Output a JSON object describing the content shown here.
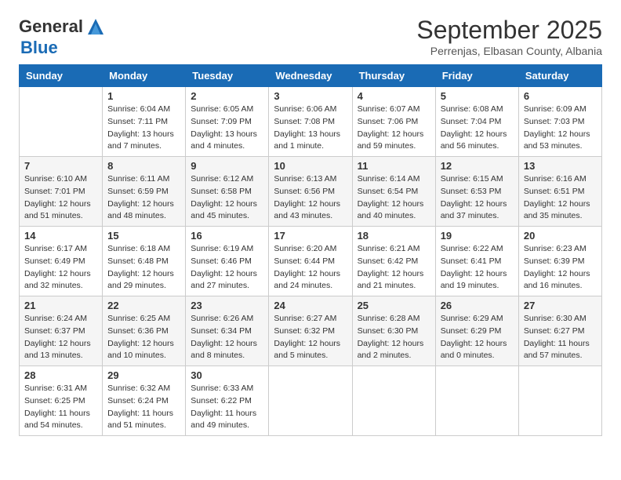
{
  "header": {
    "logo_general": "General",
    "logo_blue": "Blue",
    "month_title": "September 2025",
    "subtitle": "Perrenjas, Elbasan County, Albania"
  },
  "days_of_week": [
    "Sunday",
    "Monday",
    "Tuesday",
    "Wednesday",
    "Thursday",
    "Friday",
    "Saturday"
  ],
  "weeks": [
    [
      {
        "day": "",
        "sunrise": "",
        "sunset": "",
        "daylight": ""
      },
      {
        "day": "1",
        "sunrise": "Sunrise: 6:04 AM",
        "sunset": "Sunset: 7:11 PM",
        "daylight": "Daylight: 13 hours and 7 minutes."
      },
      {
        "day": "2",
        "sunrise": "Sunrise: 6:05 AM",
        "sunset": "Sunset: 7:09 PM",
        "daylight": "Daylight: 13 hours and 4 minutes."
      },
      {
        "day": "3",
        "sunrise": "Sunrise: 6:06 AM",
        "sunset": "Sunset: 7:08 PM",
        "daylight": "Daylight: 13 hours and 1 minute."
      },
      {
        "day": "4",
        "sunrise": "Sunrise: 6:07 AM",
        "sunset": "Sunset: 7:06 PM",
        "daylight": "Daylight: 12 hours and 59 minutes."
      },
      {
        "day": "5",
        "sunrise": "Sunrise: 6:08 AM",
        "sunset": "Sunset: 7:04 PM",
        "daylight": "Daylight: 12 hours and 56 minutes."
      },
      {
        "day": "6",
        "sunrise": "Sunrise: 6:09 AM",
        "sunset": "Sunset: 7:03 PM",
        "daylight": "Daylight: 12 hours and 53 minutes."
      }
    ],
    [
      {
        "day": "7",
        "sunrise": "Sunrise: 6:10 AM",
        "sunset": "Sunset: 7:01 PM",
        "daylight": "Daylight: 12 hours and 51 minutes."
      },
      {
        "day": "8",
        "sunrise": "Sunrise: 6:11 AM",
        "sunset": "Sunset: 6:59 PM",
        "daylight": "Daylight: 12 hours and 48 minutes."
      },
      {
        "day": "9",
        "sunrise": "Sunrise: 6:12 AM",
        "sunset": "Sunset: 6:58 PM",
        "daylight": "Daylight: 12 hours and 45 minutes."
      },
      {
        "day": "10",
        "sunrise": "Sunrise: 6:13 AM",
        "sunset": "Sunset: 6:56 PM",
        "daylight": "Daylight: 12 hours and 43 minutes."
      },
      {
        "day": "11",
        "sunrise": "Sunrise: 6:14 AM",
        "sunset": "Sunset: 6:54 PM",
        "daylight": "Daylight: 12 hours and 40 minutes."
      },
      {
        "day": "12",
        "sunrise": "Sunrise: 6:15 AM",
        "sunset": "Sunset: 6:53 PM",
        "daylight": "Daylight: 12 hours and 37 minutes."
      },
      {
        "day": "13",
        "sunrise": "Sunrise: 6:16 AM",
        "sunset": "Sunset: 6:51 PM",
        "daylight": "Daylight: 12 hours and 35 minutes."
      }
    ],
    [
      {
        "day": "14",
        "sunrise": "Sunrise: 6:17 AM",
        "sunset": "Sunset: 6:49 PM",
        "daylight": "Daylight: 12 hours and 32 minutes."
      },
      {
        "day": "15",
        "sunrise": "Sunrise: 6:18 AM",
        "sunset": "Sunset: 6:48 PM",
        "daylight": "Daylight: 12 hours and 29 minutes."
      },
      {
        "day": "16",
        "sunrise": "Sunrise: 6:19 AM",
        "sunset": "Sunset: 6:46 PM",
        "daylight": "Daylight: 12 hours and 27 minutes."
      },
      {
        "day": "17",
        "sunrise": "Sunrise: 6:20 AM",
        "sunset": "Sunset: 6:44 PM",
        "daylight": "Daylight: 12 hours and 24 minutes."
      },
      {
        "day": "18",
        "sunrise": "Sunrise: 6:21 AM",
        "sunset": "Sunset: 6:42 PM",
        "daylight": "Daylight: 12 hours and 21 minutes."
      },
      {
        "day": "19",
        "sunrise": "Sunrise: 6:22 AM",
        "sunset": "Sunset: 6:41 PM",
        "daylight": "Daylight: 12 hours and 19 minutes."
      },
      {
        "day": "20",
        "sunrise": "Sunrise: 6:23 AM",
        "sunset": "Sunset: 6:39 PM",
        "daylight": "Daylight: 12 hours and 16 minutes."
      }
    ],
    [
      {
        "day": "21",
        "sunrise": "Sunrise: 6:24 AM",
        "sunset": "Sunset: 6:37 PM",
        "daylight": "Daylight: 12 hours and 13 minutes."
      },
      {
        "day": "22",
        "sunrise": "Sunrise: 6:25 AM",
        "sunset": "Sunset: 6:36 PM",
        "daylight": "Daylight: 12 hours and 10 minutes."
      },
      {
        "day": "23",
        "sunrise": "Sunrise: 6:26 AM",
        "sunset": "Sunset: 6:34 PM",
        "daylight": "Daylight: 12 hours and 8 minutes."
      },
      {
        "day": "24",
        "sunrise": "Sunrise: 6:27 AM",
        "sunset": "Sunset: 6:32 PM",
        "daylight": "Daylight: 12 hours and 5 minutes."
      },
      {
        "day": "25",
        "sunrise": "Sunrise: 6:28 AM",
        "sunset": "Sunset: 6:30 PM",
        "daylight": "Daylight: 12 hours and 2 minutes."
      },
      {
        "day": "26",
        "sunrise": "Sunrise: 6:29 AM",
        "sunset": "Sunset: 6:29 PM",
        "daylight": "Daylight: 12 hours and 0 minutes."
      },
      {
        "day": "27",
        "sunrise": "Sunrise: 6:30 AM",
        "sunset": "Sunset: 6:27 PM",
        "daylight": "Daylight: 11 hours and 57 minutes."
      }
    ],
    [
      {
        "day": "28",
        "sunrise": "Sunrise: 6:31 AM",
        "sunset": "Sunset: 6:25 PM",
        "daylight": "Daylight: 11 hours and 54 minutes."
      },
      {
        "day": "29",
        "sunrise": "Sunrise: 6:32 AM",
        "sunset": "Sunset: 6:24 PM",
        "daylight": "Daylight: 11 hours and 51 minutes."
      },
      {
        "day": "30",
        "sunrise": "Sunrise: 6:33 AM",
        "sunset": "Sunset: 6:22 PM",
        "daylight": "Daylight: 11 hours and 49 minutes."
      },
      {
        "day": "",
        "sunrise": "",
        "sunset": "",
        "daylight": ""
      },
      {
        "day": "",
        "sunrise": "",
        "sunset": "",
        "daylight": ""
      },
      {
        "day": "",
        "sunrise": "",
        "sunset": "",
        "daylight": ""
      },
      {
        "day": "",
        "sunrise": "",
        "sunset": "",
        "daylight": ""
      }
    ]
  ]
}
